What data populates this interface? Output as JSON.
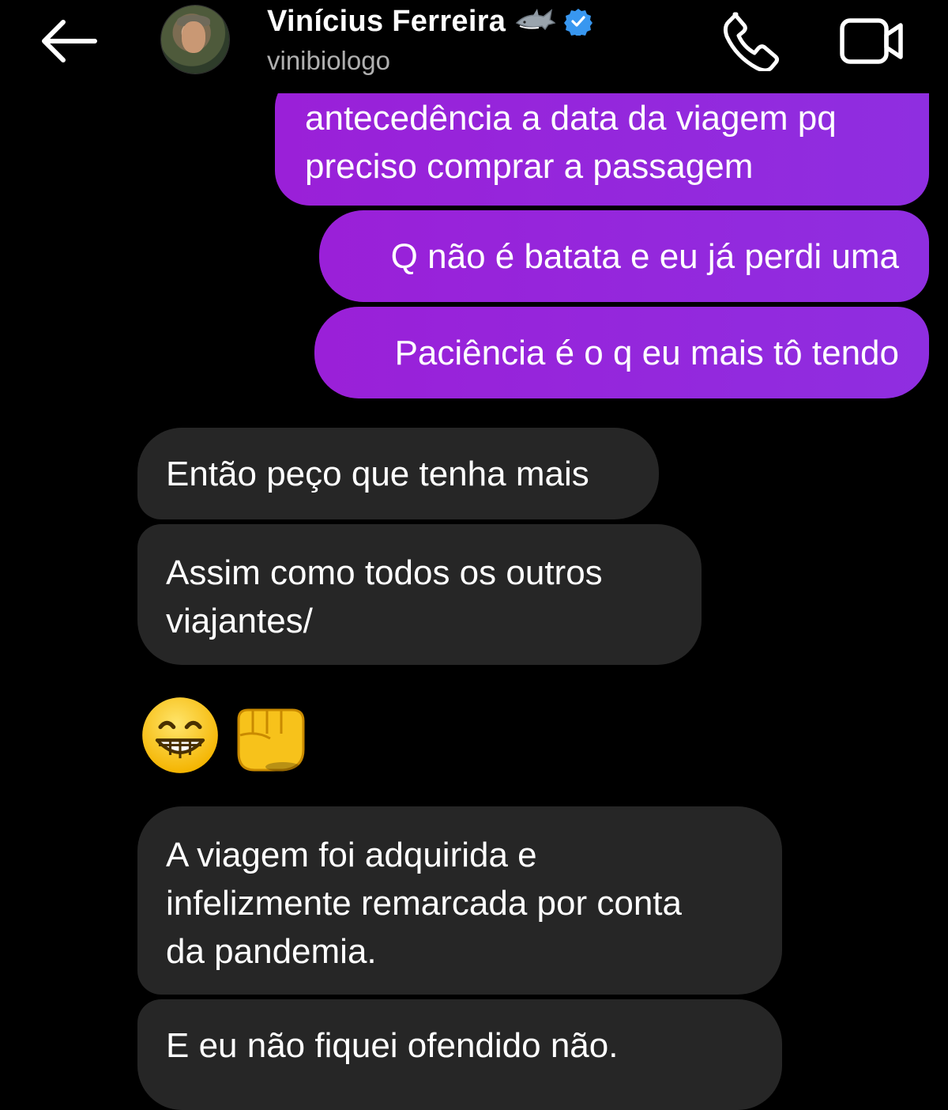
{
  "header": {
    "contact_name": "Vinícius Ferreira",
    "username": "vinibiologo",
    "icons": {
      "back": "arrow-left-icon",
      "badge_emoji": "shark-icon",
      "verified": "verified-badge-icon",
      "call": "phone-icon",
      "video": "video-camera-icon"
    },
    "verified_color": "#3897f0"
  },
  "messages": [
    {
      "direction": "outgoing",
      "text": "antecedência a data da viagem pq\npreciso comprar a passagem"
    },
    {
      "direction": "outgoing",
      "text": "Q não é batata e eu já perdi uma"
    },
    {
      "direction": "outgoing",
      "text": "Paciência é o q eu mais tô tendo"
    },
    {
      "direction": "incoming",
      "text": "Então peço que tenha mais"
    },
    {
      "direction": "incoming",
      "text": "Assim como todos os outros\nviajantes/"
    },
    {
      "direction": "incoming",
      "emoji": [
        "😁",
        "👊"
      ]
    },
    {
      "direction": "incoming",
      "text": "A viagem foi adquirida e\ninfelizmente remarcada por conta\nda pandemia."
    },
    {
      "direction": "incoming",
      "text": "E eu não fiquei ofendido não."
    }
  ],
  "colors": {
    "outgoing_bubble": "#9427dc",
    "incoming_bubble": "#262626",
    "background": "#000000",
    "username": "#b0b0b0"
  }
}
